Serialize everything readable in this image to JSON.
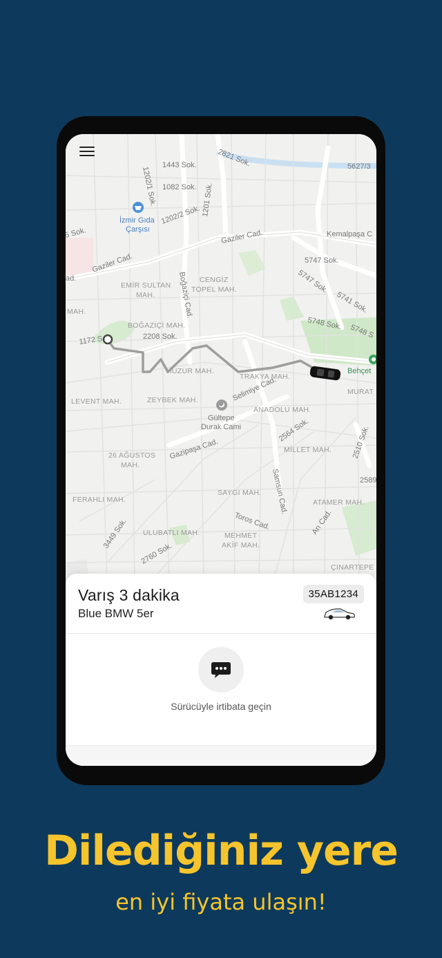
{
  "map": {
    "streets": {
      "s2821": "2821 Sok.",
      "s1443": "1443 Sok.",
      "s5627": "5627/3",
      "s1082": "1082 Sok.",
      "s1202_1": "1202/1 Sok.",
      "s1202_2": "1202/2 Sok.",
      "s1201": "1201 Sok.",
      "sok5": "5 Sok.",
      "gaziler1": "Gaziler Cad.",
      "gaziler2": "Gaziler Cad.",
      "kemalpasa": "Kemalpaşa C",
      "s5747a": "5747 Sok.",
      "s5747b": "5747 Sok.",
      "s5741": "5741 Sok.",
      "s5748a": "5748 Sok.",
      "s5748b": "5748 S",
      "bogazici_cad": "Boğaziçi Cad.",
      "s1172": "1172 S",
      "s2208": "2208 Sok.",
      "selimiye": "Selimiye Cad.",
      "s2564": "2564 Sok.",
      "s2510": "2510 Sok.",
      "gazipasa": "Gazipaşa Cad.",
      "samsun": "Samsun Cad.",
      "s2589": "2589",
      "toros": "Toros Cad.",
      "ari": "Arı Cad.",
      "s3449": "3449 Sok.",
      "s2760": "2760 Sok.",
      "ad": "ad."
    },
    "districts": {
      "emir1": "EMİR SULTAN",
      "emir2": "MAH.",
      "cengiz1": "CENGİZ",
      "cengiz2": "TOPEL MAH.",
      "bogazici": "BOĞAZİÇİ MAH.",
      "mah_left": "MAH.",
      "huzur": "HUZUR MAH.",
      "trakya": "TRAKYA MAH.",
      "levent": "LEVENT MAH.",
      "zeybek": "ZEYBEK MAH.",
      "murat": "MURAT",
      "anadolu": "ANADOLU MAH.",
      "agustos1": "26 AĞUSTOS",
      "agustos2": "MAH.",
      "millet": "MİLLET MAH.",
      "ferahli": "FERAHLI MAH.",
      "saygi": "SAYGI MAH.",
      "atamer": "ATAMER MAH.",
      "ulubatli": "ULUBATLI MAH.",
      "mehmet1": "MEHMET",
      "mehmet2": "AKİF MAH.",
      "cinartepe": "ÇINARTEPE"
    },
    "poi": {
      "market1": "İzmir Gıda",
      "market2": "Çarşısı",
      "mosque1": "Gültepe",
      "mosque2": "Durak Cami",
      "park": "Behçet"
    }
  },
  "ride": {
    "eta": "Varış 3 dakika",
    "car_model": "Blue BMW 5er",
    "plate": "35AB1234"
  },
  "contact": {
    "label": "Sürücüyle irtibata geçin"
  },
  "promo": {
    "headline": "Dilediğiniz yere",
    "subline": "en iyi fiyata ulaşın!"
  },
  "colors": {
    "background": "#0d3a5c",
    "accent": "#f6c42c",
    "route": "#9e9e9e",
    "park": "#cfe8c7"
  },
  "icons": {
    "menu": "hamburger-menu-icon",
    "chat": "chat-bubble-icon",
    "car": "taxi-car-icon",
    "origin": "route-origin-icon",
    "market": "shopping-basket-icon",
    "mosque": "mosque-icon",
    "park": "park-pin-icon"
  }
}
